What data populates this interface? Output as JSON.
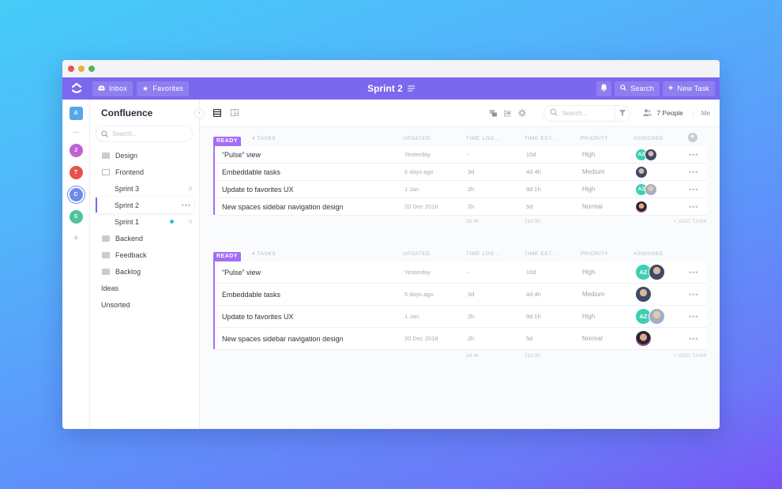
{
  "window": {
    "traffic_lights": [
      "close",
      "minimize",
      "maximize"
    ]
  },
  "topbar": {
    "logo_icon": "clickup-logo-icon",
    "inbox_label": "Inbox",
    "favorites_label": "Favorites",
    "title": "Sprint 2",
    "notifications_icon": "bell-icon",
    "search_label": "Search",
    "new_task_label": "New Task"
  },
  "rail": {
    "workspaces": [
      {
        "initial": "A",
        "color": "#5aa6e8"
      },
      {
        "initial": "J",
        "color": "#c062d6"
      },
      {
        "initial": "T",
        "color": "#e5534b"
      },
      {
        "initial": "C",
        "color": "#6d8ce8",
        "selected": true
      },
      {
        "initial": "S",
        "color": "#4fc39a"
      }
    ],
    "add_label": "+"
  },
  "sidebar": {
    "title": "Confluence",
    "search_placeholder": "Search...",
    "items": [
      {
        "label": "Design",
        "type": "folder"
      },
      {
        "label": "Frontend",
        "type": "folder-open"
      },
      {
        "label": "Sprint 3",
        "type": "list",
        "count": "8"
      },
      {
        "label": "Sprint 2",
        "type": "list",
        "active": true,
        "more": "•••"
      },
      {
        "label": "Sprint 1",
        "type": "list",
        "count": "9",
        "status_dot": "#3cc0c8"
      },
      {
        "label": "Backend",
        "type": "folder"
      },
      {
        "label": "Feedback",
        "type": "folder"
      },
      {
        "label": "Backlog",
        "type": "folder"
      },
      {
        "label": "Ideas",
        "type": "plain"
      },
      {
        "label": "Unsorted",
        "type": "plain"
      }
    ]
  },
  "toolbar": {
    "search_placeholder": "Search...",
    "people_label": "7 People",
    "me_label": "Me"
  },
  "columns": {
    "updated": "UPDATED",
    "time_logged": "TIME LOG...",
    "time_estimated": "TIME EST...",
    "priority": "PRIORITY",
    "assignee": "ASSIGNEE"
  },
  "groups": [
    {
      "status": "READY",
      "status_color": "#a26ef6",
      "task_count": "4 TASKS",
      "tasks": [
        {
          "name": "“Pulse” view",
          "updated": "Yesterday",
          "time_logged": "-",
          "time_estimated": "10d",
          "priority": "High",
          "assignees": [
            "AZ",
            "photo-1"
          ]
        },
        {
          "name": "Embeddable tasks",
          "updated": "5 days ago",
          "time_logged": "3d",
          "time_estimated": "4d 4h",
          "priority": "Medium",
          "assignees": [
            "photo-1"
          ]
        },
        {
          "name": "Update to favorites UX",
          "updated": "1 Jan",
          "time_logged": "2h",
          "time_estimated": "9d 1h",
          "priority": "High",
          "assignees": [
            "AZ",
            "photo-2"
          ]
        },
        {
          "name": "New spaces sidebar navigation design",
          "updated": "20 Dec 2018",
          "time_logged": "2h",
          "time_estimated": "5d",
          "priority": "Normal",
          "assignees": [
            "photo-3"
          ]
        }
      ],
      "totals": {
        "time_logged": "3d 4h",
        "time_estimated": "21d 5h"
      },
      "add_task_label": "+ ADD TASK"
    },
    {
      "status": "READY",
      "status_color": "#a26ef6",
      "task_count": "4 TASKS",
      "tasks": [
        {
          "name": "“Pulse” view",
          "updated": "Yesterday",
          "time_logged": "-",
          "time_estimated": "10d",
          "priority": "High",
          "assignees": [
            "AZ",
            "photo-1"
          ]
        },
        {
          "name": "Embeddable tasks",
          "updated": "5 days ago",
          "time_logged": "3d",
          "time_estimated": "4d 4h",
          "priority": "Medium",
          "assignees": [
            "photo-1"
          ]
        },
        {
          "name": "Update to favorites UX",
          "updated": "1 Jan",
          "time_logged": "2h",
          "time_estimated": "9d 1h",
          "priority": "High",
          "assignees": [
            "AZ",
            "photo-2"
          ]
        },
        {
          "name": "New spaces sidebar navigation design",
          "updated": "20 Dec 2018",
          "time_logged": "2h",
          "time_estimated": "5d",
          "priority": "Normal",
          "assignees": [
            "photo-3"
          ]
        }
      ],
      "totals": {
        "time_logged": "3d 4h",
        "time_estimated": "21d 5h"
      },
      "add_task_label": "+ ADD TASK"
    }
  ],
  "colors": {
    "accent": "#7b68ee",
    "status_ready": "#a26ef6",
    "assignee_az": "#3ecfb2"
  }
}
